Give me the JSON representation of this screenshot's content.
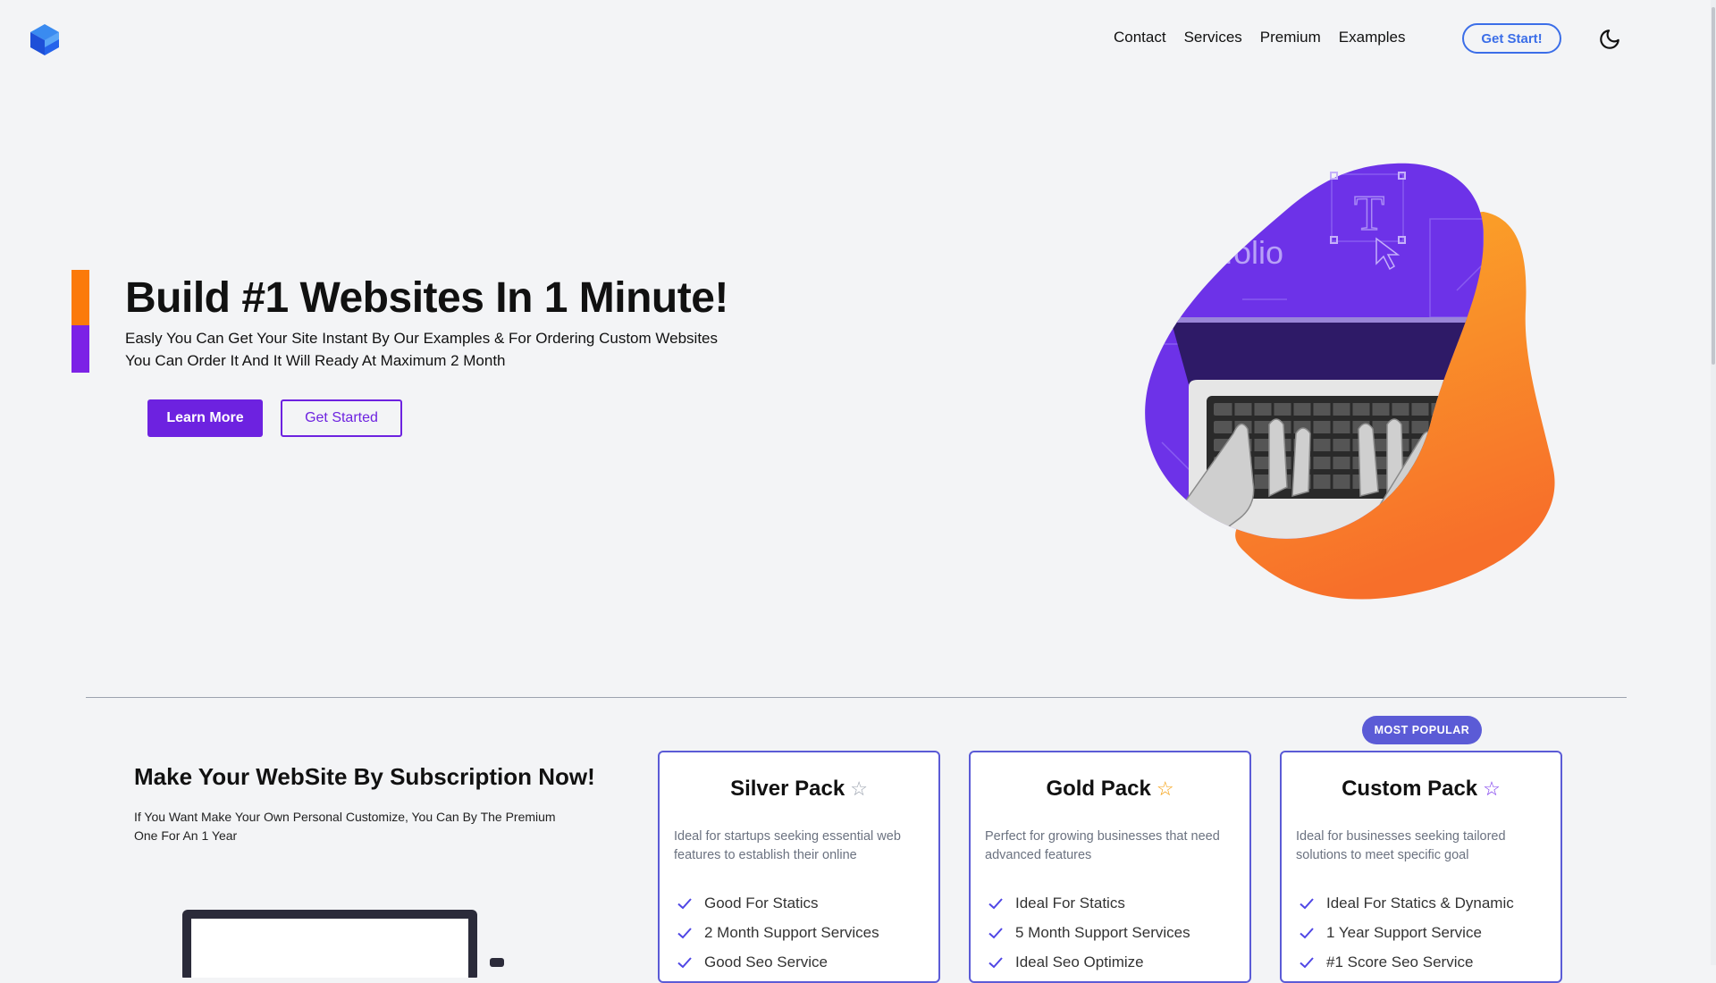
{
  "header": {
    "nav": [
      "Contact",
      "Services",
      "Premium",
      "Examples"
    ],
    "cta_label": "Get Start!"
  },
  "hero": {
    "title": "Build #1 Websites In 1 Minute!",
    "subtitle_line1": "Easly You Can Get Your Site Instant By Our Examples & For Ordering Custom Websites",
    "subtitle_line2": "You Can Order It And It Will Ready At Maximum 2 Month",
    "learn_more_label": "Learn More",
    "get_started_label": "Get Started",
    "image_text": "folio"
  },
  "subscription": {
    "title": "Make Your WebSite By Subscription Now!",
    "description": "If You Want Make Your Own Personal Customize, You Can By The Premium One For An 1 Year",
    "badge": "MOST POPULAR",
    "plans": [
      {
        "name": "Silver Pack",
        "star": "☆",
        "star_color": "#9ca3af",
        "description": "Ideal for startups seeking essential web features to establish their online",
        "features": [
          "Good For Statics",
          "2 Month Support Services",
          "Good Seo Service"
        ]
      },
      {
        "name": "Gold Pack",
        "star": "☆",
        "star_color": "#f59e0b",
        "description": "Perfect for growing businesses that need advanced features",
        "features": [
          "Ideal For Statics",
          "5 Month Support Services",
          "Ideal Seo Optimize"
        ]
      },
      {
        "name": "Custom Pack",
        "star": "☆",
        "star_color": "#7c3aed",
        "description": "Ideal for businesses seeking tailored solutions to meet specific goal",
        "features": [
          "Ideal For Statics & Dynamic",
          "1 Year Support Service",
          "#1 Score Seo Service"
        ]
      }
    ]
  },
  "colors": {
    "accent_purple": "#6d22e0",
    "accent_orange": "#fb7a0a",
    "brand_blue": "#3b6ee8",
    "card_border": "#5b5bd6"
  },
  "icons": [
    "cube-logo-icon",
    "moon-icon",
    "star-icon",
    "check-icon"
  ]
}
